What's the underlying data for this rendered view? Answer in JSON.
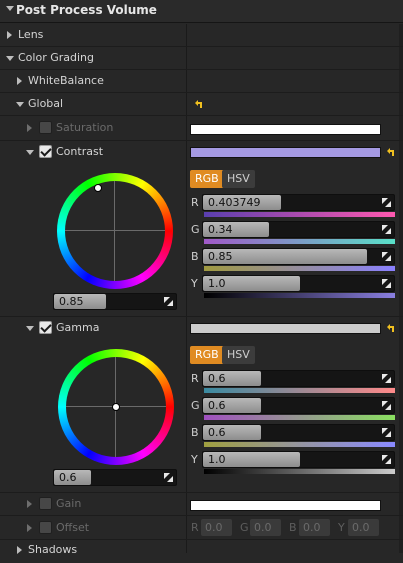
{
  "header": {
    "title": "Post Process Volume"
  },
  "rows": {
    "lens": "Lens",
    "color_grading": "Color Grading",
    "white_balance": "WhiteBalance",
    "global": "Global",
    "saturation": "Saturation",
    "contrast": "Contrast",
    "gamma": "Gamma",
    "gain": "Gain",
    "offset": "Offset",
    "shadows": "Shadows"
  },
  "contrast": {
    "tabs": [
      "RGB",
      "HSV"
    ],
    "active_tab": "RGB",
    "channels": [
      {
        "label": "R",
        "value": "0.403749",
        "fill": 0.403749
      },
      {
        "label": "G",
        "value": "0.34",
        "fill": 0.34
      },
      {
        "label": "B",
        "value": "0.85",
        "fill": 0.85
      },
      {
        "label": "Y",
        "value": "1.0",
        "fill": 0.5
      }
    ],
    "wheel_value": "0.85",
    "swatch_color": "#a59ae3"
  },
  "gamma": {
    "tabs": [
      "RGB",
      "HSV"
    ],
    "active_tab": "RGB",
    "channels": [
      {
        "label": "R",
        "value": "0.6",
        "fill": 0.3
      },
      {
        "label": "G",
        "value": "0.6",
        "fill": 0.3
      },
      {
        "label": "B",
        "value": "0.6",
        "fill": 0.3
      },
      {
        "label": "Y",
        "value": "1.0",
        "fill": 0.5
      }
    ],
    "wheel_value": "0.6",
    "swatch_color": "#cccccc"
  },
  "saturation_swatch_color": "#ffffff",
  "gain_swatch_color": "#ffffff",
  "offset_channels": [
    {
      "label": "R",
      "value": "0.0"
    },
    {
      "label": "G",
      "value": "0.0"
    },
    {
      "label": "B",
      "value": "0.0"
    },
    {
      "label": "Y",
      "value": "0.0"
    }
  ],
  "colors": {
    "accent": "#e08b22",
    "background": "#272727"
  },
  "icons": {
    "reset": "reset-arrow-icon",
    "expand": "triangle-right-icon",
    "collapse": "triangle-down-icon"
  }
}
